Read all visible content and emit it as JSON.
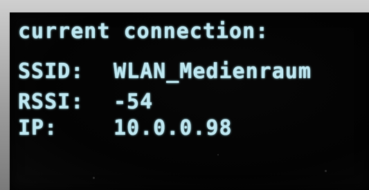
{
  "display": {
    "heading": "current connection:",
    "rows": [
      {
        "label": "SSID:",
        "value": "WLAN_Medienraum"
      },
      {
        "label": "RSSI:",
        "value": "-54"
      },
      {
        "label": "IP:",
        "value": "10.0.0.98"
      }
    ],
    "text_color": "#bfe8f2",
    "background_color": "#050505"
  }
}
